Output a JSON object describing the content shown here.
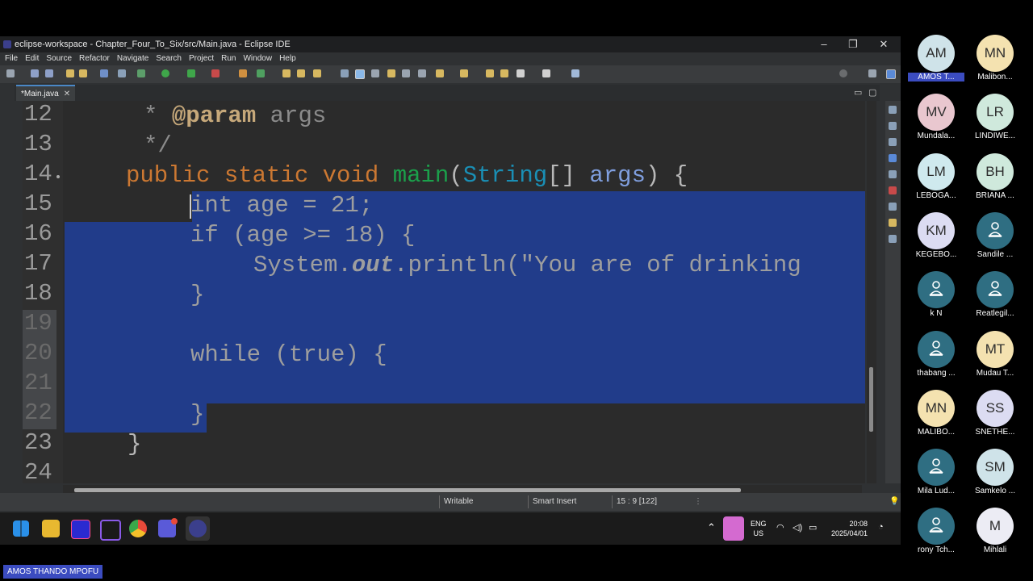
{
  "window": {
    "title": "eclipse-workspace - Chapter_Four_To_Six/src/Main.java - Eclipse IDE",
    "controls": [
      "–",
      "❐",
      "✕"
    ]
  },
  "menu": [
    "File",
    "Edit",
    "Source",
    "Refactor",
    "Navigate",
    "Search",
    "Project",
    "Run",
    "Window",
    "Help"
  ],
  "editor_tab": {
    "label": "*Main.java",
    "close": "✕"
  },
  "code": {
    "lines": [
      {
        "num": "12",
        "text": "  * @param args"
      },
      {
        "num": "13",
        "text": "  */"
      },
      {
        "num": "14",
        "text": "public static void main(String[] args) {"
      },
      {
        "num": "15",
        "text": "int age = 21;"
      },
      {
        "num": "16",
        "text": "if (age >= 18) {"
      },
      {
        "num": "17",
        "text": "System.out.println(\"You are of drinking"
      },
      {
        "num": "18",
        "text": "}"
      },
      {
        "num": "19",
        "text": ""
      },
      {
        "num": "20",
        "text": "while (true) {"
      },
      {
        "num": "21",
        "text": ""
      },
      {
        "num": "22",
        "text": "}"
      },
      {
        "num": "23",
        "text": "}"
      },
      {
        "num": "24",
        "text": ""
      }
    ]
  },
  "status": {
    "writable": "Writable",
    "insert_mode": "Smart Insert",
    "position": "15 : 9 [122]"
  },
  "taskbar": {
    "lang": "ENG",
    "region": "US",
    "time": "20:08",
    "date": "2025/04/01"
  },
  "participants": [
    {
      "initials": "AM",
      "name": "AMOS T...",
      "color": "#cfe3e9",
      "highlight": true
    },
    {
      "initials": "MN",
      "name": "Malibon...",
      "color": "#f4e2b0"
    },
    {
      "initials": "MV",
      "name": "Mundala...",
      "color": "#e9c7cf"
    },
    {
      "initials": "LR",
      "name": "LINDIWE...",
      "color": "#cfe9dc"
    },
    {
      "initials": "LM",
      "name": "LEBOGA...",
      "color": "#cfe9ee"
    },
    {
      "initials": "BH",
      "name": "BRIANA ...",
      "color": "#cfe9dc"
    },
    {
      "initials": "KM",
      "name": "KEGEBO...",
      "color": "#dcdcf2"
    },
    {
      "initials": "",
      "name": "Sandile ...",
      "color": "teal"
    },
    {
      "initials": "",
      "name": "k N",
      "color": "teal"
    },
    {
      "initials": "",
      "name": "Reatlegil...",
      "color": "teal"
    },
    {
      "initials": "",
      "name": "thabang ...",
      "color": "teal"
    },
    {
      "initials": "MT",
      "name": "Mudau T...",
      "color": "#f4e2b0"
    },
    {
      "initials": "MN",
      "name": "MALIBO...",
      "color": "#f4e2b0"
    },
    {
      "initials": "SS",
      "name": "SNETHE...",
      "color": "#dcdcf2"
    },
    {
      "initials": "",
      "name": "Mila Lud...",
      "color": "teal"
    },
    {
      "initials": "SM",
      "name": "Samkelo ...",
      "color": "#cfe3e9"
    },
    {
      "initials": "",
      "name": "rony Tch...",
      "color": "teal"
    },
    {
      "initials": "M",
      "name": "Mihlali",
      "color": "#ececf4"
    }
  ],
  "active_speaker": "AMOS THANDO MPOFU"
}
